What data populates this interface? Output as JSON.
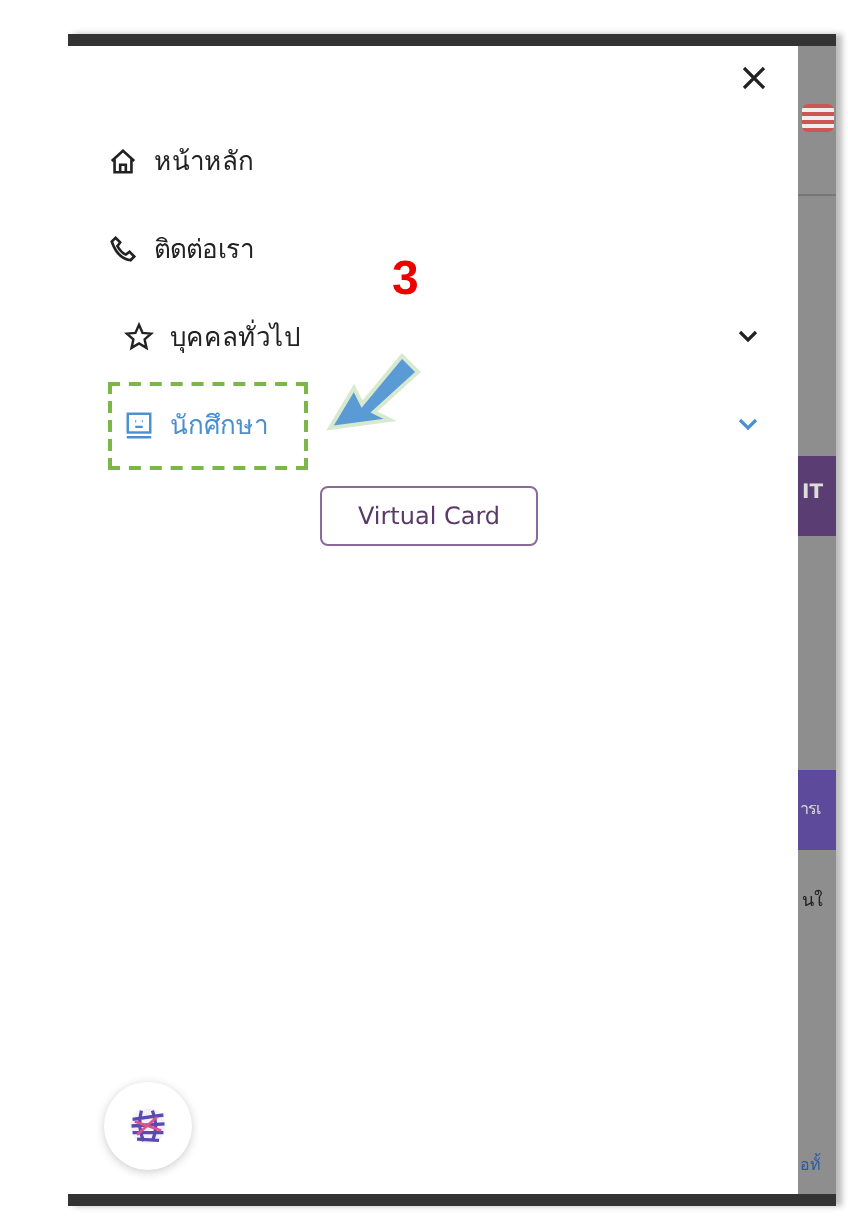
{
  "menu": {
    "items": [
      {
        "kind": "home",
        "label": "หน้าหลัก",
        "selected": false,
        "has_submenu": false
      },
      {
        "kind": "phone",
        "label": "ติดต่อเรา",
        "selected": false,
        "has_submenu": false
      },
      {
        "kind": "star",
        "label": "บุคคลทั่วไป",
        "selected": false,
        "has_submenu": true
      },
      {
        "kind": "card",
        "label": "นักศึกษา",
        "selected": true,
        "has_submenu": true
      }
    ],
    "button": "Virtual Card"
  },
  "annotation": {
    "step": "3"
  },
  "background": {
    "texts": [
      "IT",
      "ารเ",
      "นใ",
      "อทั้"
    ]
  }
}
